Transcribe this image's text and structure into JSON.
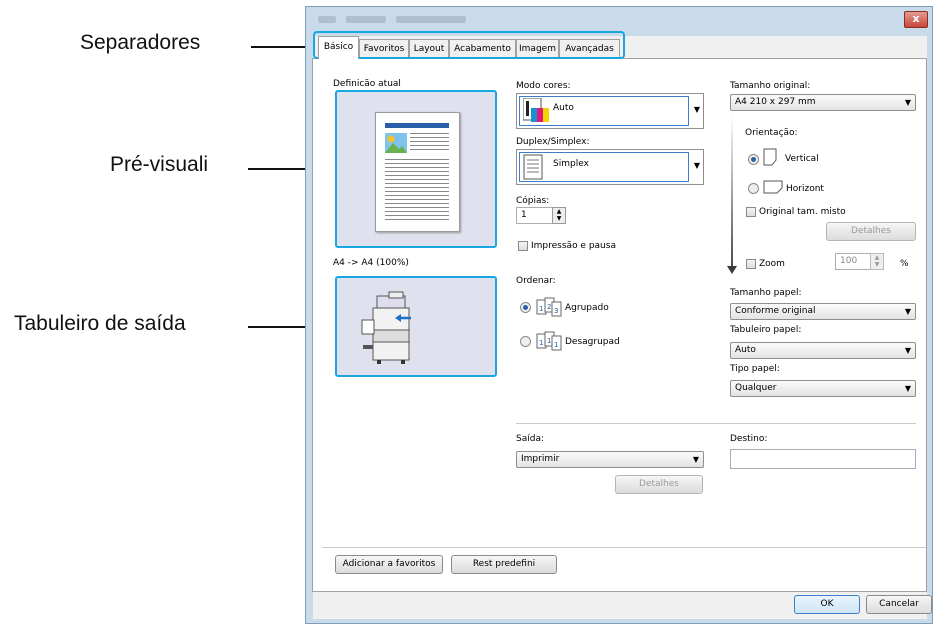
{
  "callouts": {
    "tabs": "Separadores",
    "preview": "Pré-visuali",
    "output_tray": "Tabuleiro de saída"
  },
  "window": {
    "close_glyph": "x"
  },
  "tabs": [
    "Básico",
    "Favoritos",
    "Layout",
    "Acabamento",
    "Imagem",
    "Avançadas"
  ],
  "left": {
    "current_setting_label": "Definicão atual",
    "scale_text": "A4 -> A4 (100%)"
  },
  "color_mode": {
    "label": "Modo cores:",
    "value": "Auto"
  },
  "duplex": {
    "label": "Duplex/Simplex:",
    "value": "Simplex"
  },
  "copies": {
    "label": "Cópias:",
    "value": "1"
  },
  "print_pause": {
    "label": "Impressão e pausa",
    "checked": false
  },
  "sort": {
    "label": "Ordenar:",
    "options": [
      {
        "label": "Agrupado",
        "selected": true
      },
      {
        "label": "Desagrupad",
        "selected": false
      }
    ]
  },
  "original_size": {
    "label": "Tamanho original:",
    "value": "A4 210 x 297 mm"
  },
  "orientation": {
    "label": "Orientação:",
    "options": [
      {
        "label": "Vertical",
        "selected": true
      },
      {
        "label": "Horizont",
        "selected": false
      }
    ]
  },
  "mixed_size": {
    "label": "Original tam. misto",
    "checked": false,
    "details": "Detalhes"
  },
  "zoom": {
    "label": "Zoom",
    "value": "100",
    "unit": "%",
    "checked": false
  },
  "paper_size": {
    "label": "Tamanho papel:",
    "value": "Conforme original"
  },
  "paper_tray": {
    "label": "Tabuleiro papel:",
    "value": "Auto"
  },
  "paper_type": {
    "label": "Tipo papel:",
    "value": "Qualquer"
  },
  "output": {
    "label": "Saída:",
    "value": "Imprimir",
    "details": "Detalhes"
  },
  "destination": {
    "label": "Destino:",
    "value": ""
  },
  "buttons": {
    "add_favorites": "Adicionar a favoritos",
    "reset_defaults": "Rest predefini",
    "ok": "OK",
    "cancel": "Cancelar"
  },
  "colors": {
    "accent": "#1aa7e0",
    "preview_bg": "#dfe2ee"
  }
}
